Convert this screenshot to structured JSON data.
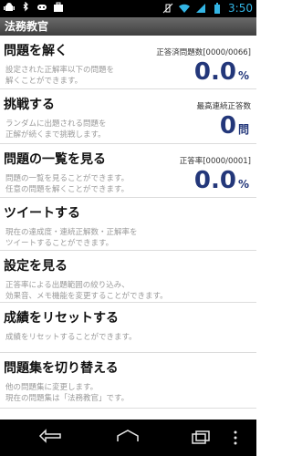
{
  "status_bar": {
    "time": "3:50"
  },
  "header": {
    "title": "法務教官"
  },
  "menu": {
    "items": [
      {
        "title": "問題を解く",
        "desc": [
          "設定された正解率以下の問題を",
          "解くことができます。"
        ],
        "stat_label": "正答済問題数[0000/0066]",
        "stat_value": "0.0",
        "stat_unit": "%"
      },
      {
        "title": "挑戦する",
        "desc": [
          "ランダムに出題される問題を",
          "正解が続くまで挑戦します。"
        ],
        "stat_label": "最高連続正答数",
        "stat_value": "0",
        "stat_unit": "問"
      },
      {
        "title": "問題の一覧を見る",
        "desc": [
          "問題の一覧を見ることができます。",
          "任意の問題を解くことができます。"
        ],
        "stat_label": "正答率[0000/0001]",
        "stat_value": "0.0",
        "stat_unit": "%"
      },
      {
        "title": "ツイートする",
        "desc": [
          "現在の達成度・連続正解数・正解率を",
          "ツイートすることができます。"
        ]
      },
      {
        "title": "設定を見る",
        "desc": [
          "正答率による出題範囲の絞り込み、",
          "効果音、メモ機能を変更することができます。"
        ]
      },
      {
        "title": "成績をリセットする",
        "desc": [
          "成績をリセットすることができます。"
        ]
      },
      {
        "title": "問題集を切り替える",
        "desc": [
          "他の問題集に変更します。",
          "現在の問題集は「法務教官」です。"
        ]
      }
    ]
  },
  "icons": {
    "status_left": [
      "android-icon",
      "bluetooth-icon",
      "game-controller-icon",
      "briefcase-icon"
    ],
    "status_right": [
      "vibrate-off-icon",
      "wifi-icon",
      "signal-icon",
      "battery-icon"
    ],
    "nav": [
      "back-icon",
      "home-icon",
      "recent-apps-icon",
      "overflow-menu-icon"
    ]
  },
  "colors": {
    "accent": "#23377a",
    "clock": "#33b5e5"
  }
}
